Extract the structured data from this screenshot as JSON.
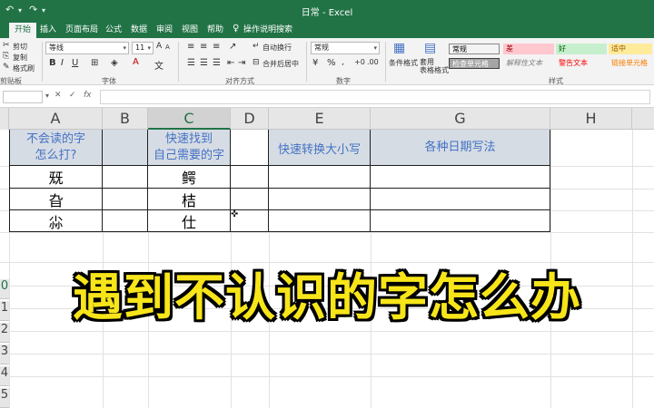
{
  "window": {
    "title": "日常 - Excel"
  },
  "quick_access": {
    "undo": "↶",
    "redo": "↷",
    "customize": "▾"
  },
  "tabs": [
    "开始",
    "插入",
    "页面布局",
    "公式",
    "数据",
    "审阅",
    "视图",
    "帮助"
  ],
  "tell_me": "操作说明搜索",
  "ribbon": {
    "clipboard": {
      "cut": "剪切",
      "copy": "复制",
      "format_painter": "格式刷",
      "label": "剪贴板"
    },
    "font": {
      "name": "等线",
      "size": "11",
      "label": "字体"
    },
    "alignment": {
      "wrap": "自动换行",
      "merge": "合并后居中",
      "label": "对齐方式"
    },
    "number": {
      "format": "常规",
      "label": "数字"
    },
    "styles": {
      "conditional": "条件格式",
      "table_format": "套用\n表格格式",
      "cell_styles": [
        {
          "text": "常规",
          "bg": "#ffffff",
          "color": "#000000"
        },
        {
          "text": "差",
          "bg": "#ffc7ce",
          "color": "#9c0006"
        },
        {
          "text": "好",
          "bg": "#c6efce",
          "color": "#006100"
        },
        {
          "text": "适中",
          "bg": "#ffeb9c",
          "color": "#9c5700"
        },
        {
          "text": "检查单元格",
          "bg": "#a5a5a5",
          "color": "#ffffff"
        },
        {
          "text": "解释性文本",
          "bg": "#ffffff",
          "color": "#7f7f7f"
        },
        {
          "text": "警告文本",
          "bg": "#ffffff",
          "color": "#ff0000"
        },
        {
          "text": "链接单元格",
          "bg": "#ffffff",
          "color": "#fa7d00"
        }
      ],
      "label": "样式"
    }
  },
  "formula_bar": {
    "fx": "fx",
    "cancel": "✕",
    "enter": "✓"
  },
  "columns": [
    "A",
    "B",
    "C",
    "D",
    "E",
    "G",
    "H"
  ],
  "selected_column": "C",
  "headers": {
    "a": "不会读的字\n怎么打?",
    "c": "快速找到\n自己需要的字",
    "e": "快速转换大小写",
    "g": "各种日期写法"
  },
  "col_a": [
    "兓",
    "旮",
    "尛"
  ],
  "col_c": [
    "鳄",
    "桔",
    "仕"
  ],
  "row_numbers": [
    "0",
    "1",
    "2",
    "3",
    "4",
    "5"
  ],
  "overlay_text": "遇到不认识的字怎么办",
  "colors": {
    "accent": "#217346",
    "header_fill": "#d6dce4",
    "header_text": "#4472c4",
    "overlay": "#f7e51a"
  }
}
